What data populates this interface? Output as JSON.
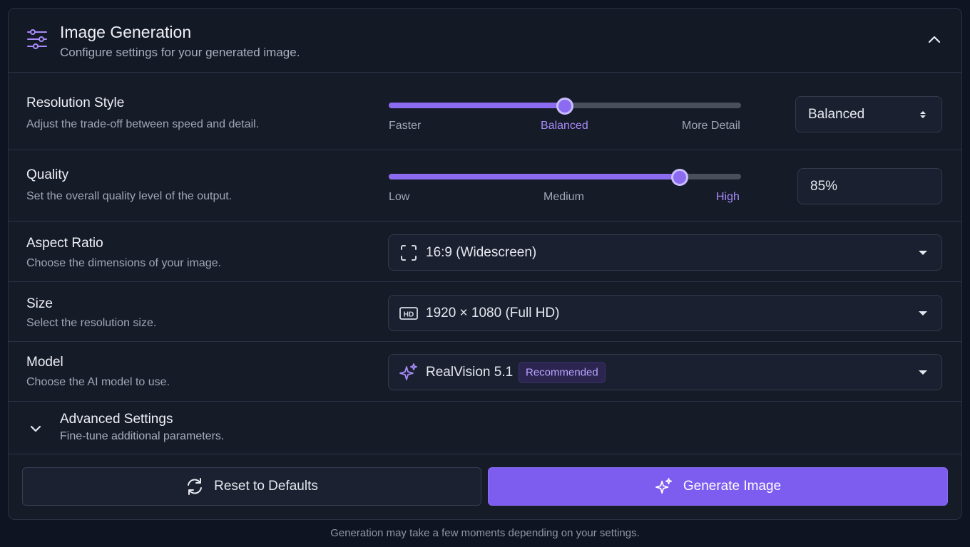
{
  "header": {
    "title": "Image Generation",
    "subtitle": "Configure settings for your generated image.",
    "icon": "sliders-icon"
  },
  "resolution": {
    "label": "Resolution Style",
    "description": "Adjust the trade-off between speed and detail.",
    "slider_value_fraction": 0.5,
    "ticks": [
      "Faster",
      "Balanced",
      "More Detail"
    ],
    "active_tick": "Balanced",
    "select_value": "Balanced"
  },
  "quality": {
    "label": "Quality",
    "description": "Set the overall quality level of the output.",
    "slider_value_fraction": 0.825,
    "ticks": [
      "Low",
      "Medium",
      "High"
    ],
    "active_tick": "High",
    "value": "85%"
  },
  "aspect": {
    "label": "Aspect Ratio",
    "description": "Choose the dimensions of your image.",
    "value": "16:9 (Widescreen)",
    "icon": "aspect-ratio-icon"
  },
  "size": {
    "label": "Size",
    "description": "Select the resolution size.",
    "value": "1920 × 1080 (Full HD)",
    "icon": "hd-icon"
  },
  "model": {
    "label": "Model",
    "description": "Choose the AI model to use.",
    "value": "RealVision 5.1",
    "badge": "Recommended",
    "icon": "sparkles-icon"
  },
  "advanced": {
    "title": "Advanced Settings",
    "subtitle": "Fine-tune additional parameters."
  },
  "actions": {
    "reset_label": "Reset to Defaults",
    "generate_label": "Generate Image"
  },
  "footer_note": "Generation may take a few moments depending on your settings.",
  "colors": {
    "accent": "#8b6cf0",
    "accent_text": "#a78bfa",
    "background": "#0f1422",
    "panel": "#161b28"
  }
}
